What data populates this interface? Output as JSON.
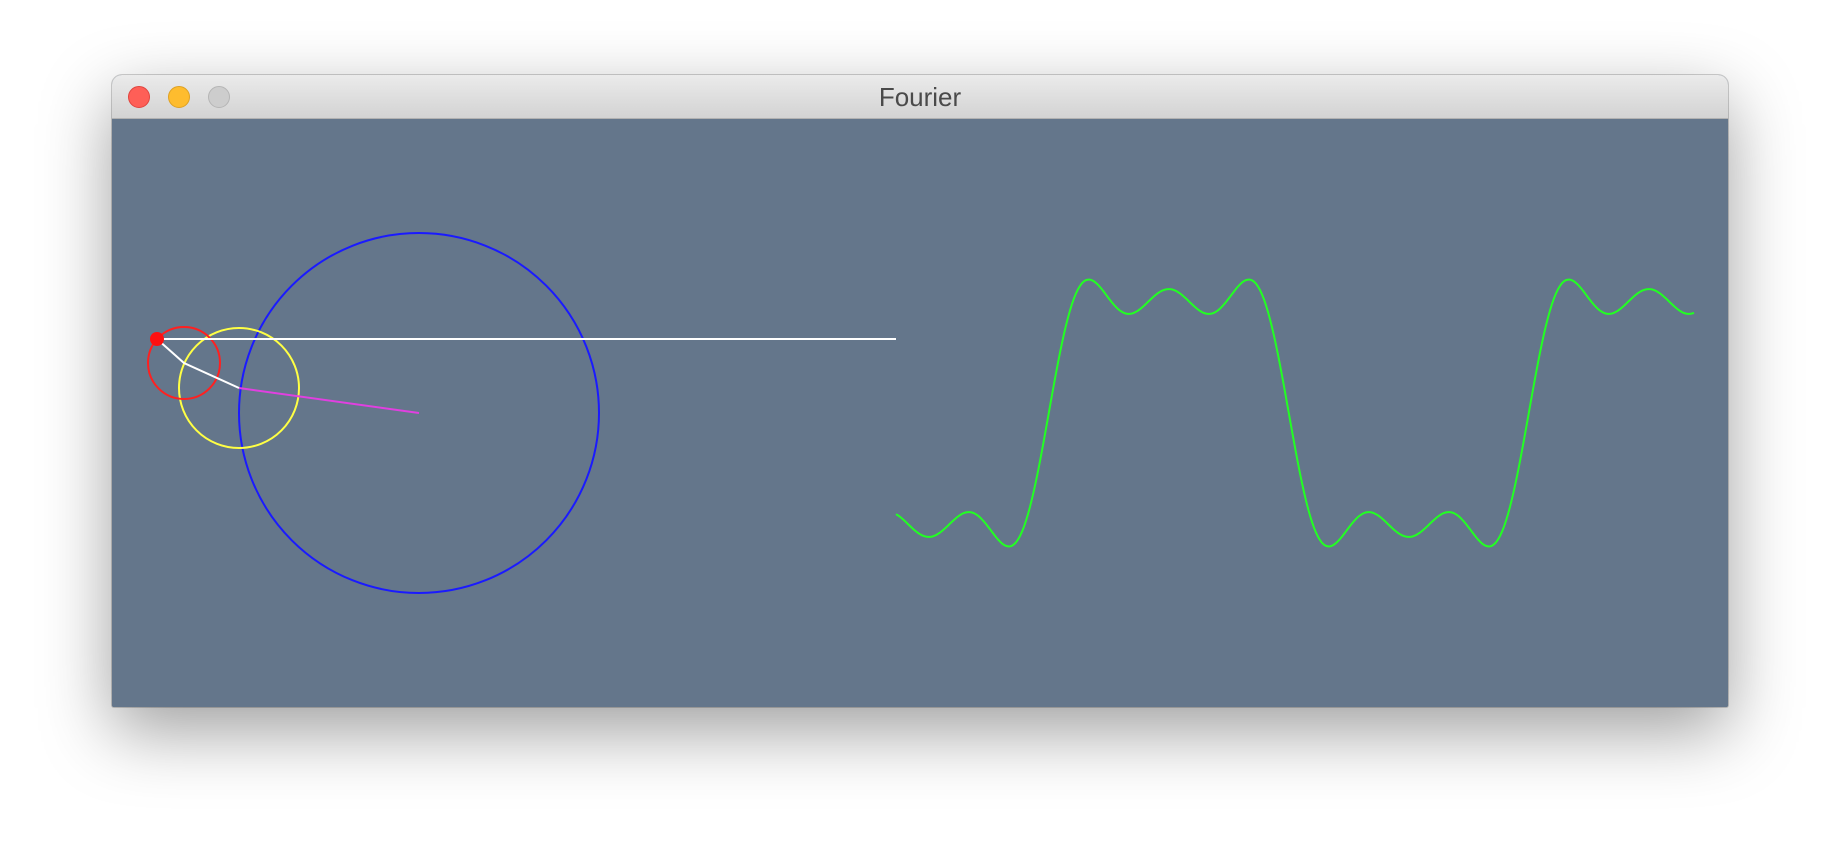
{
  "window": {
    "title": "Fourier"
  },
  "colors": {
    "background": "#64768b",
    "circle_large": "#1a1aff",
    "circle_medium": "#ffff44",
    "circle_small": "#ff2020",
    "radius_primary": "#e040e0",
    "radius_secondary": "#ffffff",
    "trace_line": "#ffffff",
    "tip_point": "#ff1010",
    "wave": "#22ff22"
  },
  "icons": {
    "close": "close-icon",
    "minimize": "minimize-icon",
    "zoom": "zoom-icon"
  }
}
